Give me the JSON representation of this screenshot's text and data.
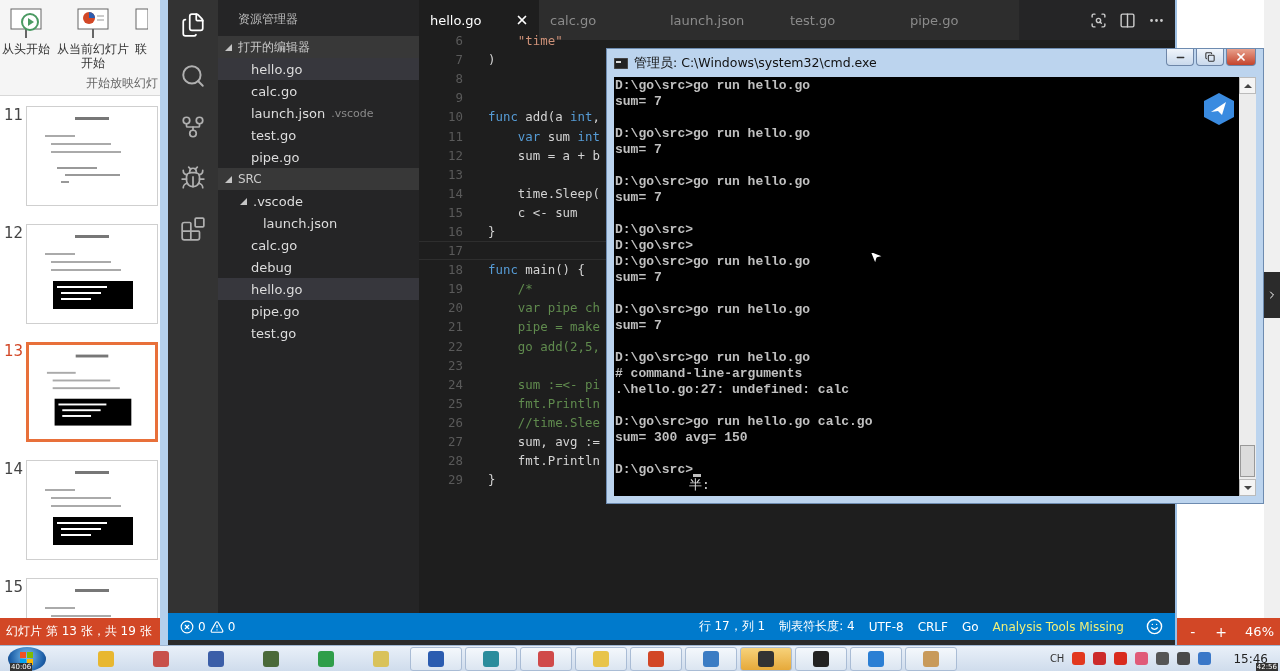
{
  "powerpoint": {
    "ribbon": {
      "buttons": [
        {
          "label": "从头开始",
          "kind": "from-start"
        },
        {
          "label": "从当前幻灯片开始",
          "kind": "from-current"
        },
        {
          "label": "联",
          "kind": "online"
        }
      ],
      "group_label": "开始放映幻灯"
    },
    "slides": [
      {
        "number": "11",
        "selected": false,
        "code_block": false
      },
      {
        "number": "12",
        "selected": false,
        "code_block": true
      },
      {
        "number": "13",
        "selected": true,
        "code_block": true
      },
      {
        "number": "14",
        "selected": false,
        "code_block": true
      },
      {
        "number": "15",
        "selected": false
      }
    ],
    "status": "幻灯片 第 13 张，共 19 张",
    "zoom": {
      "minus": "-",
      "plus": "+",
      "value": "46%"
    }
  },
  "vscode": {
    "activity_bar": [
      {
        "kind": "explorer",
        "selected": true
      },
      {
        "kind": "search",
        "selected": false
      },
      {
        "kind": "git",
        "selected": false
      },
      {
        "kind": "debug",
        "selected": false
      },
      {
        "kind": "extensions",
        "selected": false
      }
    ],
    "sidebar": {
      "title": "资源管理器",
      "sections": [
        {
          "label": "打开的编辑器",
          "expanded": true,
          "items": [
            {
              "label": "hello.go",
              "selected": true
            },
            {
              "label": "calc.go",
              "selected": false
            },
            {
              "label": "launch.json",
              "detail": ".vscode",
              "selected": false
            },
            {
              "label": "test.go",
              "selected": false
            },
            {
              "label": "pipe.go",
              "selected": false
            }
          ]
        },
        {
          "label": "SRC",
          "expanded": true,
          "items": [
            {
              "label": ".vscode",
              "selected": false,
              "expanded": true,
              "children": [
                {
                  "label": "launch.json",
                  "selected": false
                }
              ]
            },
            {
              "label": "calc.go",
              "selected": false
            },
            {
              "label": "debug",
              "selected": false
            },
            {
              "label": "hello.go",
              "selected": true
            },
            {
              "label": "pipe.go",
              "selected": false
            },
            {
              "label": "test.go",
              "selected": false
            }
          ]
        }
      ]
    },
    "tabs": [
      {
        "label": "hello.go",
        "selected": true,
        "close_button": true
      },
      {
        "label": "calc.go",
        "selected": false,
        "close_button": false
      },
      {
        "label": "launch.json",
        "selected": false,
        "close_button": false
      },
      {
        "label": "test.go",
        "selected": false,
        "close_button": false
      },
      {
        "label": "pipe.go",
        "selected": false,
        "close_button": false
      }
    ],
    "code_lines": [
      {
        "number": "6",
        "current": false,
        "tokens": [
          {
            "text": "    \"time\"",
            "kind": "string"
          }
        ]
      },
      {
        "number": "7",
        "current": false,
        "tokens": [
          {
            "text": ")",
            "kind": "plain"
          }
        ]
      },
      {
        "number": "8",
        "current": false
      },
      {
        "number": "9",
        "current": false
      },
      {
        "number": "10",
        "current": false,
        "tokens": [
          {
            "text": "func",
            "kind": "keyword"
          },
          {
            "text": " add(a ",
            "kind": "plain"
          },
          {
            "text": "int",
            "kind": "keyword"
          },
          {
            "text": ",",
            "kind": "plain"
          }
        ]
      },
      {
        "number": "11",
        "current": false,
        "tokens": [
          {
            "text": "    var",
            "kind": "keyword"
          },
          {
            "text": " sum ",
            "kind": "plain"
          },
          {
            "text": "int",
            "kind": "keyword"
          }
        ]
      },
      {
        "number": "12",
        "current": false,
        "tokens": [
          {
            "text": "    sum = a + b",
            "kind": "plain"
          }
        ]
      },
      {
        "number": "13",
        "current": false
      },
      {
        "number": "14",
        "current": false,
        "tokens": [
          {
            "text": "    time.Sleep(",
            "kind": "plain"
          }
        ]
      },
      {
        "number": "15",
        "current": false,
        "tokens": [
          {
            "text": "    c <- sum",
            "kind": "plain"
          }
        ]
      },
      {
        "number": "16",
        "current": false,
        "tokens": [
          {
            "text": "}",
            "kind": "plain"
          }
        ]
      },
      {
        "number": "17",
        "current": true
      },
      {
        "number": "18",
        "current": false,
        "tokens": [
          {
            "text": "func",
            "kind": "keyword"
          },
          {
            "text": " main() {",
            "kind": "plain"
          }
        ]
      },
      {
        "number": "19",
        "current": false,
        "tokens": [
          {
            "text": "    /*",
            "kind": "comment"
          }
        ]
      },
      {
        "number": "20",
        "current": false,
        "tokens": [
          {
            "text": "    var pipe ch",
            "kind": "comment"
          }
        ]
      },
      {
        "number": "21",
        "current": false,
        "tokens": [
          {
            "text": "    pipe = make",
            "kind": "comment"
          }
        ]
      },
      {
        "number": "22",
        "current": false,
        "tokens": [
          {
            "text": "    go add(2,5,",
            "kind": "comment"
          }
        ]
      },
      {
        "number": "23",
        "current": false
      },
      {
        "number": "24",
        "current": false,
        "tokens": [
          {
            "text": "    sum :=<- pi",
            "kind": "comment"
          }
        ]
      },
      {
        "number": "25",
        "current": false,
        "tokens": [
          {
            "text": "    fmt.Println",
            "kind": "comment"
          }
        ]
      },
      {
        "number": "26",
        "current": false,
        "tokens": [
          {
            "text": "    //time.Slee",
            "kind": "comment"
          }
        ]
      },
      {
        "number": "27",
        "current": false,
        "tokens": [
          {
            "text": "    sum, avg :=",
            "kind": "plain"
          }
        ]
      },
      {
        "number": "28",
        "current": false,
        "tokens": [
          {
            "text": "    fmt.Println",
            "kind": "plain"
          }
        ]
      },
      {
        "number": "29",
        "current": false,
        "tokens": [
          {
            "text": "}",
            "kind": "plain"
          }
        ]
      }
    ],
    "status_bar": {
      "errors": "0",
      "warnings": "0",
      "items": [
        "行 17，列 1",
        "制表符长度: 4",
        "UTF-8",
        "CRLF",
        "Go"
      ],
      "analysis": "Analysis Tools Missing"
    }
  },
  "cmd": {
    "title": "管理员: C:\\Windows\\system32\\cmd.exe",
    "cursor": true,
    "ime_status": "半:",
    "lines": [
      {
        "text": "D:\\go\\src>go run hello.go",
        "gap_after": false
      },
      {
        "text": "sum= 7",
        "gap_after": true
      },
      {
        "text": "D:\\go\\src>go run hello.go",
        "gap_after": false
      },
      {
        "text": "sum= 7",
        "gap_after": true
      },
      {
        "text": "D:\\go\\src>go run hello.go",
        "gap_after": false
      },
      {
        "text": "sum= 7",
        "gap_after": true
      },
      {
        "text": "D:\\go\\src>",
        "gap_after": false
      },
      {
        "text": "D:\\go\\src>",
        "gap_after": false
      },
      {
        "text": "D:\\go\\src>go run hello.go",
        "gap_after": false
      },
      {
        "text": "sum= 7",
        "gap_after": true
      },
      {
        "text": "D:\\go\\src>go run hello.go",
        "gap_after": false
      },
      {
        "text": "sum= 7",
        "gap_after": true
      },
      {
        "text": "D:\\go\\src>go run hello.go",
        "gap_after": false
      },
      {
        "text": "# command-line-arguments",
        "gap_after": false
      },
      {
        "text": ".\\hello.go:27: undefined: calc",
        "gap_after": true
      },
      {
        "text": "D:\\go\\src>go run hello.go calc.go",
        "gap_after": false
      },
      {
        "text": "sum= 300 avg= 150",
        "gap_after": true
      },
      {
        "text": "D:\\go\\src>",
        "gap_after": false
      }
    ]
  },
  "taskbar": {
    "video_elapsed": "40:06",
    "apps": [
      {
        "color": "#e8b730",
        "running": false,
        "selected": false
      },
      {
        "color": "#c8504a",
        "running": false,
        "selected": false
      },
      {
        "color": "#3b5ea8",
        "running": false,
        "selected": false
      },
      {
        "color": "#4a6a3a",
        "running": false,
        "selected": false
      },
      {
        "color": "#2f9e4a",
        "running": false,
        "selected": false
      },
      {
        "color": "#d9c25a",
        "running": false,
        "selected": false
      },
      {
        "color": "#2b5cb0",
        "running": true,
        "selected": false
      },
      {
        "color": "#2a8c9c",
        "running": true,
        "selected": false
      },
      {
        "color": "#d04a4a",
        "running": true,
        "selected": false
      },
      {
        "color": "#e8c44a",
        "running": true,
        "selected": false
      },
      {
        "color": "#d24726",
        "running": true,
        "selected": false
      },
      {
        "color": "#3a7cc4",
        "running": true,
        "selected": false
      },
      {
        "color": "#333333",
        "running": true,
        "selected": true
      },
      {
        "color": "#222222",
        "running": true,
        "selected": false
      },
      {
        "color": "#2b7fd4",
        "running": true,
        "selected": false
      },
      {
        "color": "#c89a5a",
        "running": true,
        "selected": false
      }
    ],
    "language": "CH",
    "tray": [
      {
        "color": "#e2381e"
      },
      {
        "color": "#cc2a2a"
      },
      {
        "color": "#d92b1e"
      },
      {
        "color": "#e05a78"
      },
      {
        "color": "#555555"
      },
      {
        "color": "#4a4a4a"
      },
      {
        "color": "#3a78c8"
      }
    ],
    "time": "15:46",
    "video_total": "42:56"
  }
}
